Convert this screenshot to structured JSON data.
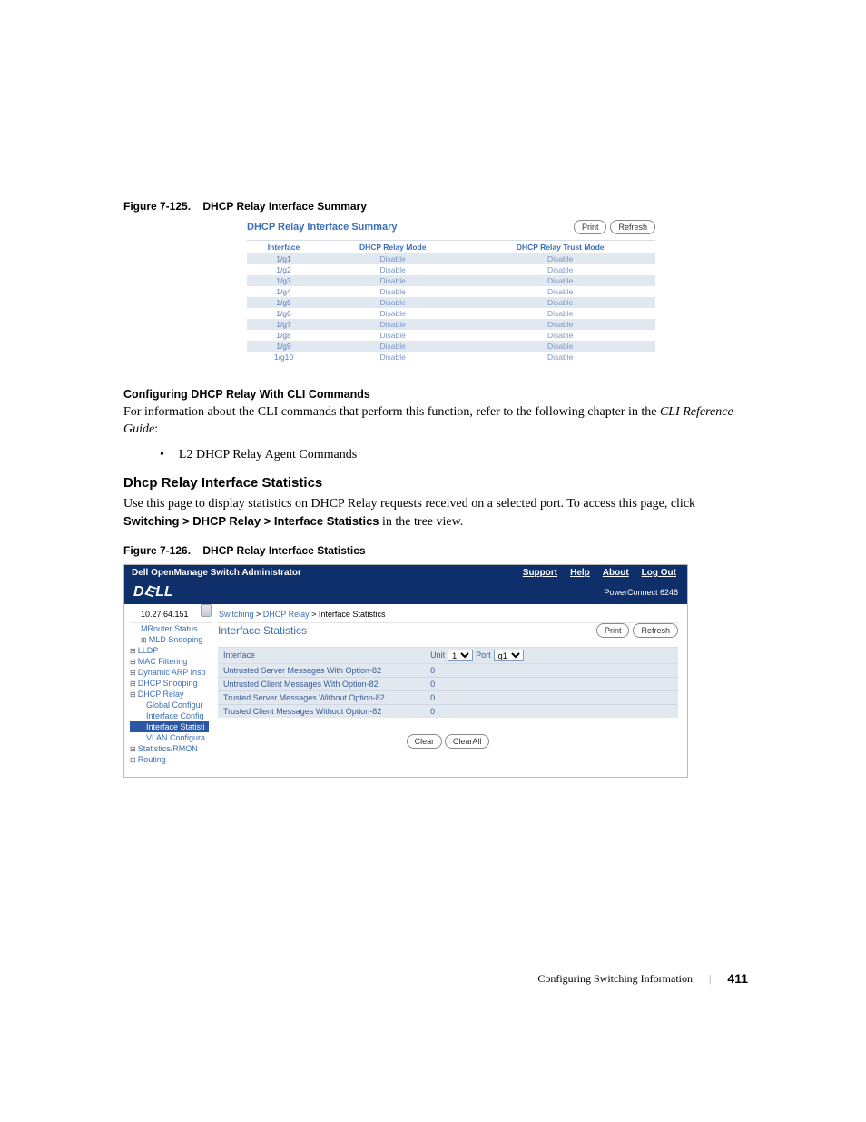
{
  "figure125": {
    "caption_prefix": "Figure 7-125.",
    "caption_title": "DHCP Relay Interface Summary",
    "panel_title": "DHCP Relay Interface Summary",
    "print_btn": "Print",
    "refresh_btn": "Refresh",
    "columns": {
      "interface": "Interface",
      "mode": "DHCP Relay Mode",
      "trust": "DHCP Relay Trust Mode"
    },
    "rows": [
      {
        "if": "1/g1",
        "mode": "Disable",
        "trust": "Disable"
      },
      {
        "if": "1/g2",
        "mode": "Disable",
        "trust": "Disable"
      },
      {
        "if": "1/g3",
        "mode": "Disable",
        "trust": "Disable"
      },
      {
        "if": "1/g4",
        "mode": "Disable",
        "trust": "Disable"
      },
      {
        "if": "1/g5",
        "mode": "Disable",
        "trust": "Disable"
      },
      {
        "if": "1/g6",
        "mode": "Disable",
        "trust": "Disable"
      },
      {
        "if": "1/g7",
        "mode": "Disable",
        "trust": "Disable"
      },
      {
        "if": "1/g8",
        "mode": "Disable",
        "trust": "Disable"
      },
      {
        "if": "1/g9",
        "mode": "Disable",
        "trust": "Disable"
      },
      {
        "if": "1/g10",
        "mode": "Disable",
        "trust": "Disable"
      }
    ]
  },
  "prose": {
    "subhead1": "Configuring DHCP Relay With CLI Commands",
    "para1a": "For information about the CLI commands that perform this function, refer to the following chapter in the ",
    "para1b": "CLI Reference Guide",
    "para1c": ":",
    "bullet": "•",
    "bullet_text": "L2 DHCP Relay Agent Commands",
    "section_head": "Dhcp Relay Interface Statistics",
    "para2a": "Use this page to display statistics on DHCP Relay requests received on a selected port. To access this page, click ",
    "para2b": "Switching > DHCP Relay > Interface Statistics",
    "para2c": " in the tree view."
  },
  "figure126": {
    "caption_prefix": "Figure 7-126.",
    "caption_title": "DHCP Relay Interface Statistics",
    "app_title": "Dell OpenManage Switch Administrator",
    "top_links": {
      "support": "Support",
      "help": "Help",
      "about": "About",
      "logout": "Log Out"
    },
    "device_name": "PowerConnect 6248",
    "ip": "10.27.64.151",
    "tree": {
      "mrouter": "MRouter Status",
      "mld": "MLD Snooping",
      "lldp": "LLDP",
      "mac": "MAC Filtering",
      "dai": "Dynamic ARP Insp",
      "dsnoop": "DHCP Snooping",
      "drelay": "DHCP Relay",
      "gconf": "Global Configur",
      "ifconf": "Interface Config",
      "ifstat": "Interface Statisti",
      "vlanconf": "VLAN Configura",
      "stats": "Statistics/RMON",
      "routing": "Routing"
    },
    "breadcrumb": {
      "a": "Switching",
      "b": "DHCP Relay",
      "c": "Interface Statistics",
      "sep": " > "
    },
    "panel_title": "Interface Statistics",
    "print_btn": "Print",
    "refresh_btn": "Refresh",
    "interface_row": {
      "label": "Interface",
      "unit_label": "Unit",
      "unit_val": "1",
      "port_label": "Port",
      "port_val": "g1"
    },
    "stats": [
      {
        "label": "Untrusted Server Messages With Option-82",
        "value": "0"
      },
      {
        "label": "Untrusted Client Messages With Option-82",
        "value": "0"
      },
      {
        "label": "Trusted Server Messages Without Option-82",
        "value": "0"
      },
      {
        "label": "Trusted Client Messages Without Option-82",
        "value": "0"
      }
    ],
    "clear_btn": "Clear",
    "clearall_btn": "ClearAll"
  },
  "footer": {
    "text": "Configuring Switching Information",
    "page": "411"
  }
}
